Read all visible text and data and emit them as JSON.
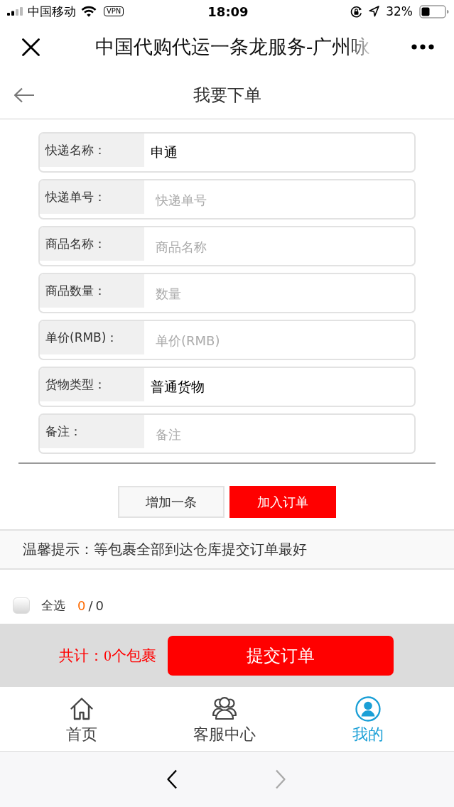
{
  "status_bar": {
    "carrier": "中国移动",
    "vpn": "VPN",
    "time": "18:09",
    "battery": "32%"
  },
  "browser_header": {
    "title": "中国代购代运一条龙服务-广州咏"
  },
  "page_header": {
    "title": "我要下单"
  },
  "form": {
    "fields": [
      {
        "label": "快递名称：",
        "value": "申通"
      },
      {
        "label": "快递单号：",
        "placeholder": "快递单号"
      },
      {
        "label": "商品名称：",
        "placeholder": "商品名称"
      },
      {
        "label": "商品数量：",
        "placeholder": "数量"
      },
      {
        "label": "单价(RMB)：",
        "placeholder": "单价(RMB)"
      },
      {
        "label": "货物类型：",
        "value": "普通货物"
      },
      {
        "label": "备注：",
        "placeholder": "备注"
      }
    ]
  },
  "actions": [
    {
      "label": "增加一条",
      "kind": "secondary"
    },
    {
      "label": "加入订单",
      "kind": "primary"
    }
  ],
  "tip": "温馨提示：等包裹全部到达仓库提交订单最好",
  "select_all": {
    "label": "全选",
    "checked": false,
    "selected_count": "0",
    "separator": "/",
    "total": "0"
  },
  "summary": {
    "total": "共计：0个包裹",
    "submit": "提交订单"
  },
  "tab_bar": [
    {
      "label": "首页",
      "kind": "home",
      "selected": false
    },
    {
      "label": "客服中心",
      "kind": "people",
      "selected": false
    },
    {
      "label": "我的",
      "kind": "profile",
      "selected": true
    }
  ],
  "browser_nav": [
    {
      "kind": "back",
      "disabled": false
    },
    {
      "kind": "forward",
      "disabled": true
    }
  ]
}
